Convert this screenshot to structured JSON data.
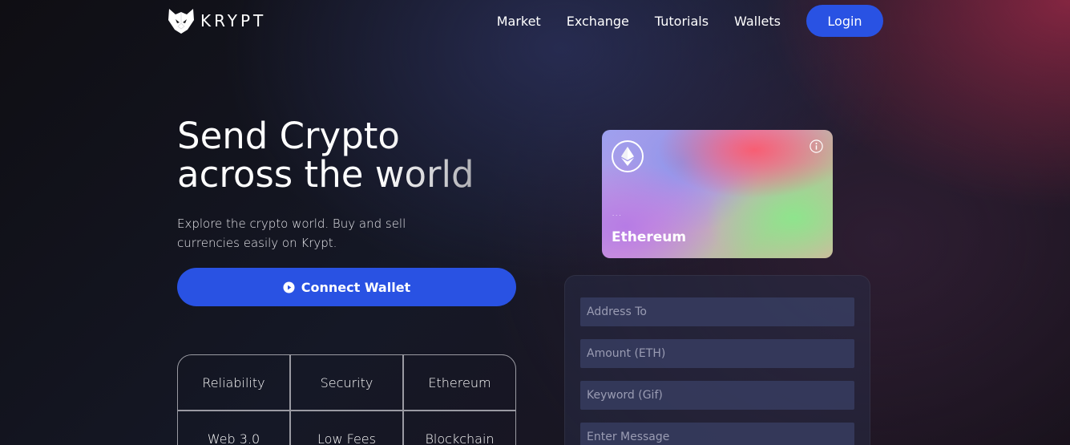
{
  "brand": {
    "name": "KRYPT"
  },
  "nav": {
    "items": [
      {
        "label": "Market"
      },
      {
        "label": "Exchange"
      },
      {
        "label": "Tutorials"
      },
      {
        "label": "Wallets"
      }
    ],
    "login_label": "Login"
  },
  "hero": {
    "title_line1": "Send Crypto",
    "title_line2": "across the world",
    "subtitle": "Explore the crypto world. Buy and sell currencies easily on Krypt.",
    "connect_label": "Connect Wallet"
  },
  "features": [
    {
      "label": "Reliability"
    },
    {
      "label": "Security"
    },
    {
      "label": "Ethereum"
    },
    {
      "label": "Web 3.0"
    },
    {
      "label": "Low Fees"
    },
    {
      "label": "Blockchain"
    }
  ],
  "card": {
    "address": "...",
    "network": "Ethereum"
  },
  "form": {
    "address_placeholder": "Address To",
    "amount_placeholder": "Amount (ETH)",
    "keyword_placeholder": "Keyword (Gif)",
    "message_placeholder": "Enter Message"
  },
  "colors": {
    "accent": "#2952e3",
    "background": "#0f0e13"
  },
  "icons": {
    "logo": "krypt-fox-logo",
    "connect": "play-circle-icon",
    "card": "ethereum-icon",
    "info": "info-icon"
  }
}
